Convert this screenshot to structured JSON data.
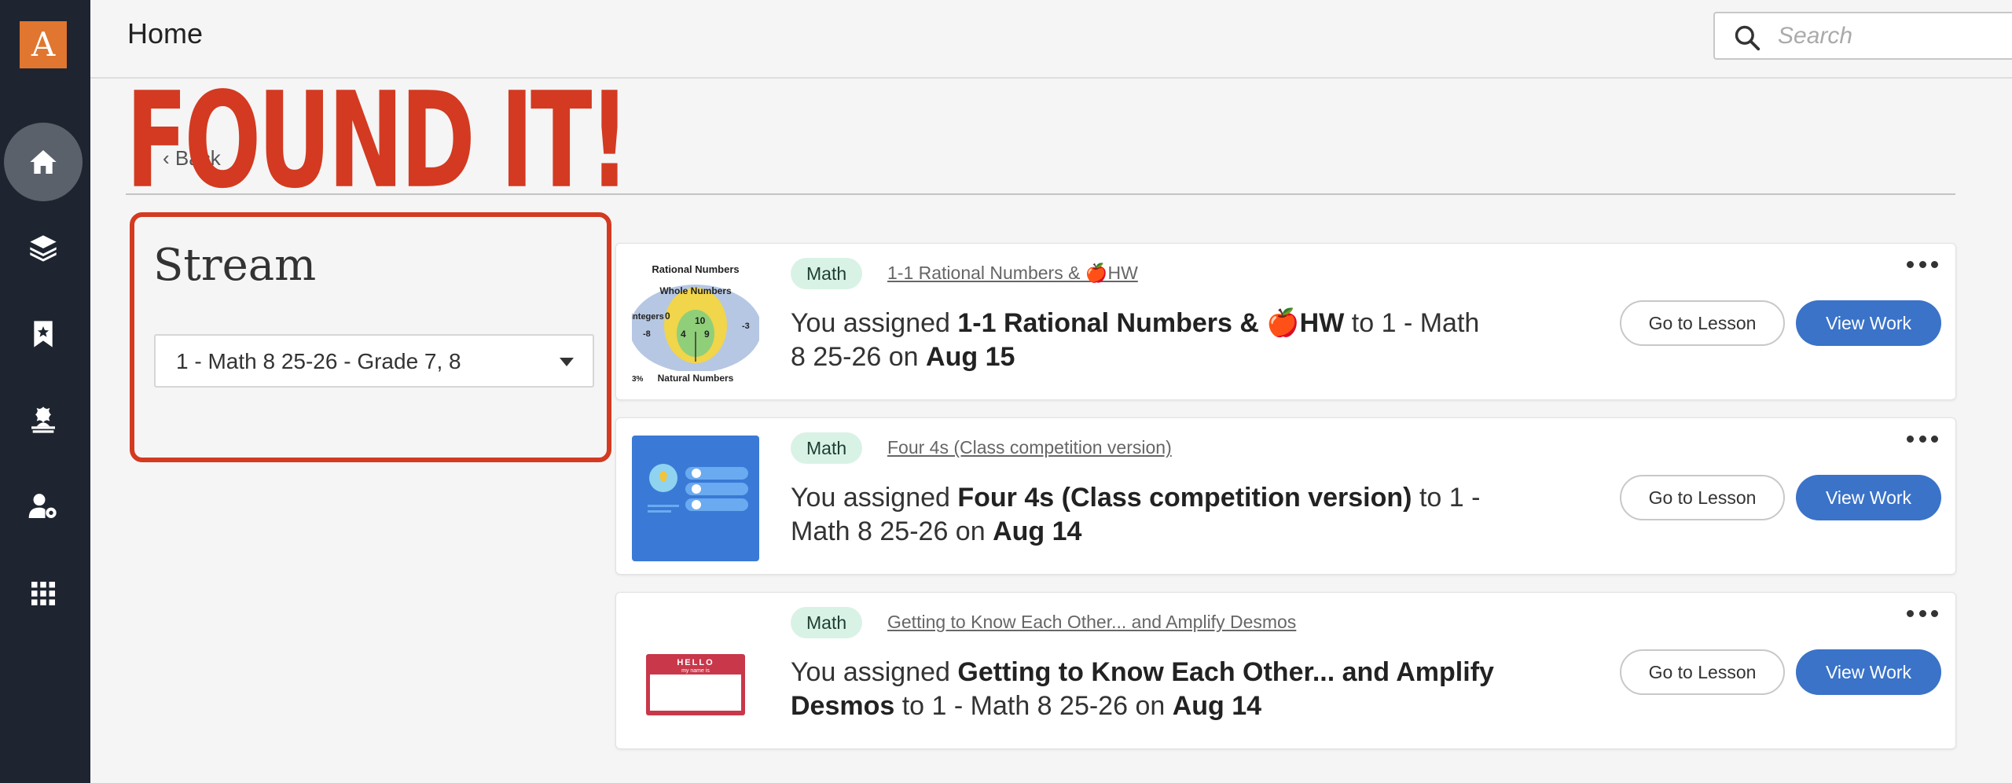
{
  "app": {
    "logo_letter": "A",
    "brand_color": "#e0762f",
    "sidebar_color": "#1e2530"
  },
  "sidebar": {
    "items": [
      {
        "icon": "home-icon",
        "active": true
      },
      {
        "icon": "layers-icon",
        "active": false
      },
      {
        "icon": "bookmark-star-icon",
        "active": false
      },
      {
        "icon": "teacher-icon",
        "active": false
      },
      {
        "icon": "user-settings-icon",
        "active": false
      },
      {
        "icon": "apps-grid-icon",
        "active": false
      }
    ]
  },
  "header": {
    "title": "Home",
    "search_placeholder": "Search"
  },
  "overlay": {
    "banner_text": "FOUND IT!",
    "banner_color": "#d33a21"
  },
  "breadcrumb": {
    "back_label": "Back"
  },
  "stream": {
    "title": "Stream",
    "class_selected": "1 - Math 8 25-26 - Grade 7, 8"
  },
  "cards": [
    {
      "tag": "Math",
      "lesson_link": "1-1 Rational Numbers & 🍎HW",
      "text_prefix": "You assigned ",
      "lesson_bold": "1-1 Rational Numbers & 🍎HW",
      "text_mid": " to 1 - Math 8 25-26 on ",
      "date": "Aug 15",
      "thumb": {
        "title": "Rational Numbers",
        "inner": "Whole Numbers",
        "label_integers": "Integers",
        "label_natural": "Natural Numbers",
        "nums": [
          "0",
          "10",
          "4",
          "9",
          "-8",
          "-3"
        ],
        "edge_text": "3%"
      },
      "go_label": "Go to Lesson",
      "view_label": "View Work"
    },
    {
      "tag": "Math",
      "lesson_link": "Four 4s (Class competition version)",
      "text_prefix": "You assigned ",
      "lesson_bold": "Four 4s (Class competition version)",
      "text_mid": " to 1 - Math 8 25-26 on ",
      "date": "Aug 14",
      "go_label": "Go to Lesson",
      "view_label": "View Work"
    },
    {
      "tag": "Math",
      "lesson_link": "Getting to Know Each Other... and Amplify Desmos",
      "text_prefix": "You assigned ",
      "lesson_bold": "Getting to Know Each Other... and Amplify Desmos",
      "text_mid": " to 1 - Math 8 25-26 on ",
      "date": "Aug 14",
      "thumb": {
        "hello": "HELLO",
        "name_is": "my name is"
      },
      "go_label": "Go to Lesson",
      "view_label": "View Work"
    }
  ]
}
